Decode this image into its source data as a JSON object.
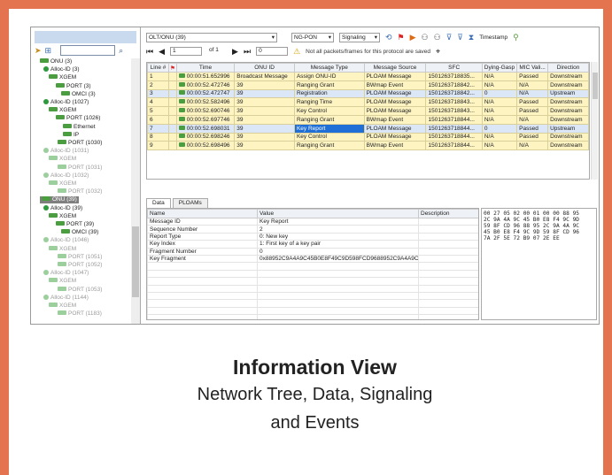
{
  "tree": {
    "nodes": [
      {
        "label": "ONU (3)",
        "dim": false,
        "sel": false
      },
      {
        "label": "Alloc-ID (3)",
        "dim": false,
        "sel": false
      },
      {
        "label": "XGEM",
        "dim": false,
        "sel": false
      },
      {
        "label": "PORT (3)",
        "dim": false,
        "sel": false
      },
      {
        "label": "OMCI (3)",
        "dim": false,
        "sel": false
      },
      {
        "label": "Alloc-ID (1027)",
        "dim": false,
        "sel": false
      },
      {
        "label": "XGEM",
        "dim": false,
        "sel": false
      },
      {
        "label": "PORT (1026)",
        "dim": false,
        "sel": false
      },
      {
        "label": "Ethernet",
        "dim": false,
        "sel": false
      },
      {
        "label": "IP",
        "dim": false,
        "sel": false
      },
      {
        "label": "PORT (1030)",
        "dim": false,
        "sel": false
      },
      {
        "label": "Alloc-ID (1031)",
        "dim": true,
        "sel": false
      },
      {
        "label": "XGEM",
        "dim": true,
        "sel": false
      },
      {
        "label": "PORT (1031)",
        "dim": true,
        "sel": false
      },
      {
        "label": "Alloc-ID (1032)",
        "dim": true,
        "sel": false
      },
      {
        "label": "XGEM",
        "dim": true,
        "sel": false
      },
      {
        "label": "PORT (1032)",
        "dim": true,
        "sel": false
      },
      {
        "label": "ONU (39)",
        "dim": false,
        "sel": true
      },
      {
        "label": "Alloc-ID (39)",
        "dim": false,
        "sel": false
      },
      {
        "label": "XGEM",
        "dim": false,
        "sel": false
      },
      {
        "label": "PORT (39)",
        "dim": false,
        "sel": false
      },
      {
        "label": "OMCI (39)",
        "dim": false,
        "sel": false
      },
      {
        "label": "Alloc-ID (1046)",
        "dim": true,
        "sel": false
      },
      {
        "label": "XGEM",
        "dim": true,
        "sel": false
      },
      {
        "label": "PORT (1051)",
        "dim": true,
        "sel": false
      },
      {
        "label": "PORT (1052)",
        "dim": true,
        "sel": false
      },
      {
        "label": "Alloc-ID (1047)",
        "dim": true,
        "sel": false
      },
      {
        "label": "XGEM",
        "dim": true,
        "sel": false
      },
      {
        "label": "PORT (1053)",
        "dim": true,
        "sel": false
      },
      {
        "label": "Alloc-ID (1144)",
        "dim": true,
        "sel": false
      },
      {
        "label": "XGEM",
        "dim": true,
        "sel": false
      },
      {
        "label": "PORT (1183)",
        "dim": true,
        "sel": false
      }
    ]
  },
  "toolbar": {
    "olt_combo": "OLT/ONU (39)",
    "mode_combo": "NG-PON",
    "signal_combo": "Signaling",
    "timestamp_label": "Timestamp",
    "page_field": "1",
    "page_of": "of 1",
    "goto_field": "0",
    "warn_text": "Not all packets/frames for this protocol are saved"
  },
  "grid": {
    "columns": [
      "Line #",
      "Time",
      "ONU ID",
      "Message Type",
      "Message Source",
      "SFC",
      "Dying-Gasp",
      "MIC Vali...",
      "Direction"
    ],
    "rows": [
      {
        "line": "1",
        "time": "00:00:51.652996",
        "onu": "Broadcast Message",
        "type": "Assign ONU-ID",
        "source": "PLOAM Message",
        "sfc": "1501263718835...",
        "dg": "N/A",
        "mic": "Passed",
        "dir": "Downstream",
        "style": "y"
      },
      {
        "line": "2",
        "time": "00:00:52.472746",
        "onu": "39",
        "type": "Ranging Grant",
        "source": "BWmap Event",
        "sfc": "1501263718842...",
        "dg": "N/A",
        "mic": "N/A",
        "dir": "Downstream",
        "style": "y"
      },
      {
        "line": "3",
        "time": "00:00:52.472747",
        "onu": "39",
        "type": "Registration",
        "source": "PLOAM Message",
        "sfc": "1501263718842...",
        "dg": "0",
        "mic": "N/A",
        "dir": "Upstream",
        "style": "b"
      },
      {
        "line": "4",
        "time": "00:00:52.582496",
        "onu": "39",
        "type": "Ranging Time",
        "source": "PLOAM Message",
        "sfc": "1501263718843...",
        "dg": "N/A",
        "mic": "Passed",
        "dir": "Downstream",
        "style": "y"
      },
      {
        "line": "5",
        "time": "00:00:52.690746",
        "onu": "39",
        "type": "Key Control",
        "source": "PLOAM Message",
        "sfc": "1501263718843...",
        "dg": "N/A",
        "mic": "Passed",
        "dir": "Downstream",
        "style": "y"
      },
      {
        "line": "6",
        "time": "00:00:52.697746",
        "onu": "39",
        "type": "Ranging Grant",
        "source": "BWmap Event",
        "sfc": "1501263718844...",
        "dg": "N/A",
        "mic": "N/A",
        "dir": "Downstream",
        "style": "y"
      },
      {
        "line": "7",
        "time": "00:00:52.698031",
        "onu": "39",
        "type": "Key Report",
        "source": "PLOAM Message",
        "sfc": "1501263718844...",
        "dg": "0",
        "mic": "Passed",
        "dir": "Upstream",
        "style": "b",
        "highlight": true
      },
      {
        "line": "8",
        "time": "00:00:52.698246",
        "onu": "39",
        "type": "Key Control",
        "source": "PLOAM Message",
        "sfc": "1501263718844...",
        "dg": "N/A",
        "mic": "Passed",
        "dir": "Downstream",
        "style": "y"
      },
      {
        "line": "9",
        "time": "00:00:52.698496",
        "onu": "39",
        "type": "Ranging Grant",
        "source": "BWmap Event",
        "sfc": "1501263718844...",
        "dg": "N/A",
        "mic": "N/A",
        "dir": "Downstream",
        "style": "y"
      }
    ]
  },
  "tabs": [
    "Data",
    "PLOAMs"
  ],
  "detail": {
    "columns": [
      "Name",
      "Value",
      "Description"
    ],
    "rows": [
      {
        "name": "Message ID",
        "value": "Key Report"
      },
      {
        "name": "Sequence Number",
        "value": "2"
      },
      {
        "name": "Report Type",
        "value": "0: New key"
      },
      {
        "name": "Key Index",
        "value": "1: First key of a key pair"
      },
      {
        "name": "Fragment Number",
        "value": "0"
      },
      {
        "name": "Key Fragment",
        "value": "0x88952C9A4A9C45B0E8F49C9D598FCD9688952C9A4A9C45..."
      }
    ]
  },
  "hex": "00 27 05 02 00 01 00 00 88 95\n2C 9A 4A 9C 45 B0 E8 F4 9C 9D\n59 8F CD 96 88 95 2C 9A 4A 9C\n45 B0 E8 F4 9C 9D 59 8F CD 96\n7A 2F 5E 72 B9 07 2E EE",
  "caption": {
    "title": "Information View",
    "line1": "Network Tree, Data, Signaling",
    "line2": "and Events"
  }
}
